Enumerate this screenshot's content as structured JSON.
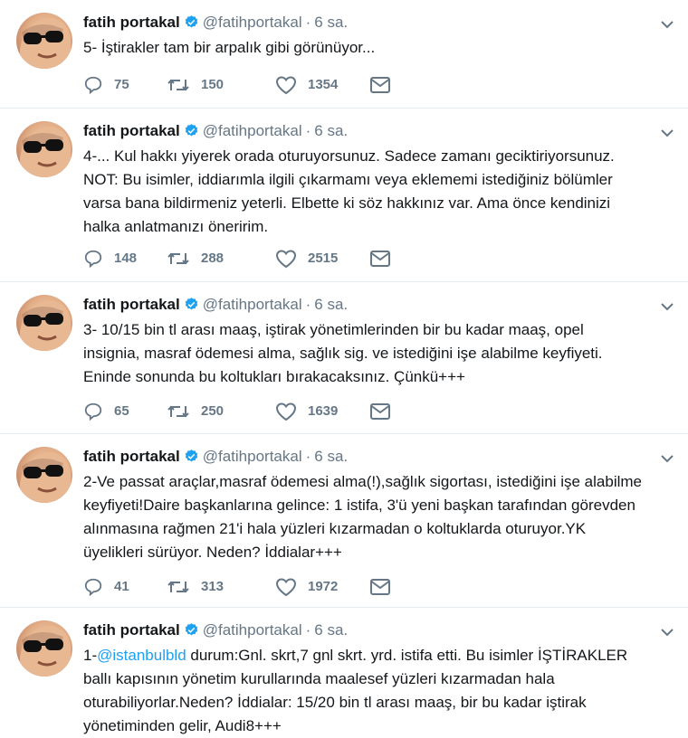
{
  "icons": {
    "verified": "verified-badge-icon",
    "caret": "chevron-down-icon",
    "reply": "reply-icon",
    "retweet": "retweet-icon",
    "like": "heart-icon",
    "dm": "envelope-icon"
  },
  "colors": {
    "accent": "#1da1f2",
    "muted": "#657786",
    "text": "#14171a",
    "divider": "#e6ecf0"
  },
  "tweets": [
    {
      "name": "fatih portakal",
      "handle": "@fatihportakal",
      "dot": "·",
      "time": "6 sa.",
      "text": "5- İştirakler tam bir arpalık gibi görünüyor...",
      "replies": "75",
      "retweets": "150",
      "likes": "1354"
    },
    {
      "name": "fatih portakal",
      "handle": "@fatihportakal",
      "dot": "·",
      "time": "6 sa.",
      "text": "4-... Kul hakkı yiyerek orada oturuyorsunuz. Sadece zamanı geciktiriyorsunuz.\nNOT: Bu isimler, iddiarımla ilgili çıkarmamı veya eklememi istediğiniz bölümler\nvarsa bana bildirmeniz yeterli. Elbette ki söz hakkınız var. Ama önce kendinizi\nhalka anlatmanızı öneririm.",
      "replies": "148",
      "retweets": "288",
      "likes": "2515"
    },
    {
      "name": "fatih portakal",
      "handle": "@fatihportakal",
      "dot": "·",
      "time": "6 sa.",
      "text": "3- 10/15 bin tl arası maaş, iştirak yönetimlerinden bir bu kadar maaş, opel\ninsignia, masraf ödemesi alma, sağlık sig. ve istediğini işe alabilme keyfiyeti.\nEninde sonunda bu koltukları bırakacaksınız. Çünkü+++",
      "replies": "65",
      "retweets": "250",
      "likes": "1639"
    },
    {
      "name": "fatih portakal",
      "handle": "@fatihportakal",
      "dot": "·",
      "time": "6 sa.",
      "text": "2-Ve passat araçlar,masraf ödemesi alma(!),sağlık sigortası, istediğini işe alabilme\nkeyfiyeti!Daire başkanlarına gelince: 1 istifa, 3'ü yeni başkan tarafından görevden\nalınmasına rağmen 21'i hala yüzleri kızarmadan o koltuklarda oturuyor.YK\nüyelikleri sürüyor. Neden? İddialar+++",
      "replies": "41",
      "retweets": "313",
      "likes": "1972"
    },
    {
      "name": "fatih portakal",
      "handle": "@fatihportakal",
      "dot": "·",
      "time": "6 sa.",
      "text_prefix": "1-",
      "mention": "@istanbulbld",
      "text": " durum:Gnl. skrt,7 gnl skrt. yrd. istifa etti. Bu isimler İŞTİRAKLER\nballı kapısının yönetim kurullarında maalesef yüzleri kızarmadan hala\noturabiliyorlar.Neden? İddialar: 15/20 bin tl arası maaş, bir bu kadar iştirak\nyönetiminden gelir, Audi8+++"
    }
  ]
}
